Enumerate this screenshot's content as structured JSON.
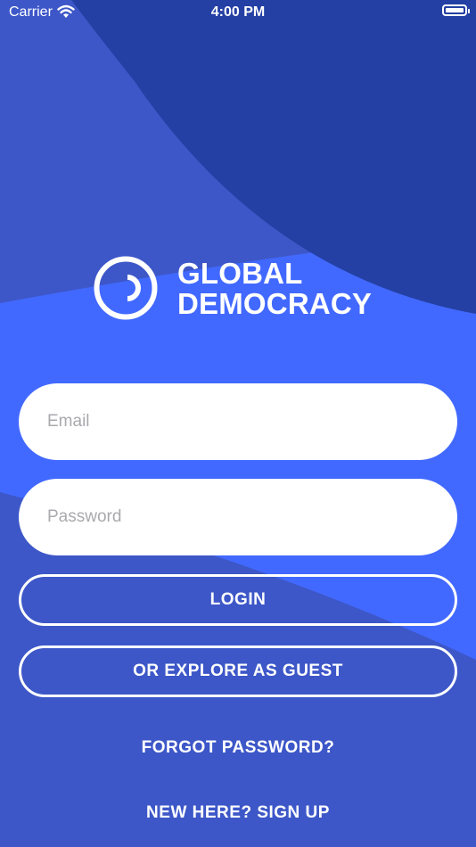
{
  "status_bar": {
    "carrier": "Carrier",
    "time": "4:00 PM"
  },
  "logo": {
    "line1": "GLOBAL",
    "line2": "DEMOCRACY"
  },
  "form": {
    "email_placeholder": "Email",
    "password_placeholder": "Password"
  },
  "buttons": {
    "login": "LOGIN",
    "guest": "OR EXPLORE AS GUEST"
  },
  "links": {
    "forgot": "FORGOT PASSWORD?",
    "signup": "NEW HERE? SIGN UP"
  },
  "colors": {
    "dark_blue": "#2440A4",
    "mid_blue": "#3D57C8",
    "bright_blue": "#4269FF",
    "white": "#FFFFFF"
  }
}
